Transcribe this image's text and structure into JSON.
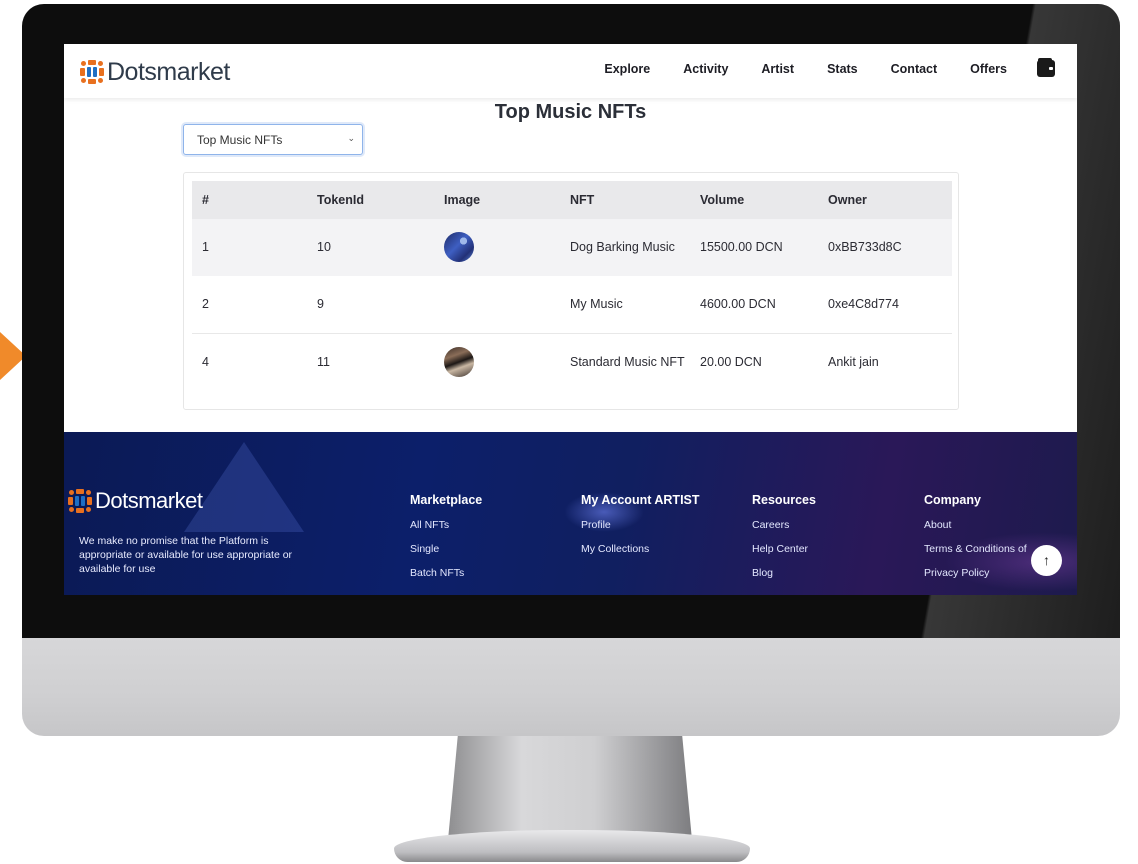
{
  "brand": {
    "name": "Dotsmarket",
    "accent": "#f08a2a",
    "logo_colors": [
      "#e8701f",
      "#1f6fc4"
    ]
  },
  "nav": {
    "links": [
      "Explore",
      "Activity",
      "Artist",
      "Stats",
      "Contact",
      "Offers"
    ],
    "wallet_icon": "wallet-icon"
  },
  "page": {
    "title": "Top Music NFTs",
    "select_value": "Top Music NFTs"
  },
  "table": {
    "headers": [
      "#",
      "TokenId",
      "Image",
      "NFT",
      "Volume",
      "Owner"
    ],
    "rows": [
      {
        "rank": "1",
        "token": "10",
        "image": "thumbnail",
        "nft": "Dog Barking Music",
        "volume": "15500.00 DCN",
        "owner": "0xBB733d8C"
      },
      {
        "rank": "2",
        "token": "9",
        "image": "",
        "nft": "My Music",
        "volume": "4600.00 DCN",
        "owner": "0xe4C8d774"
      },
      {
        "rank": "4",
        "token": "11",
        "image": "thumbnail",
        "nft": "Standard Music NFT",
        "volume": "20.00 DCN",
        "owner": "Ankit jain"
      }
    ]
  },
  "footer": {
    "description": "We make no promise that the Platform is appropriate or available for use appropriate or available for use",
    "columns": [
      {
        "title": "Marketplace",
        "links": [
          "All NFTs",
          "Single",
          "Batch NFTs"
        ]
      },
      {
        "title": "My Account ARTIST",
        "links": [
          "Profile",
          "My Collections"
        ]
      },
      {
        "title": "Resources",
        "links": [
          "Careers",
          "Help Center",
          "Blog"
        ]
      },
      {
        "title": "Company",
        "links": [
          "About",
          "Terms & Conditions of",
          "Privacy Policy"
        ]
      }
    ],
    "back_to_top_glyph": "↑"
  }
}
